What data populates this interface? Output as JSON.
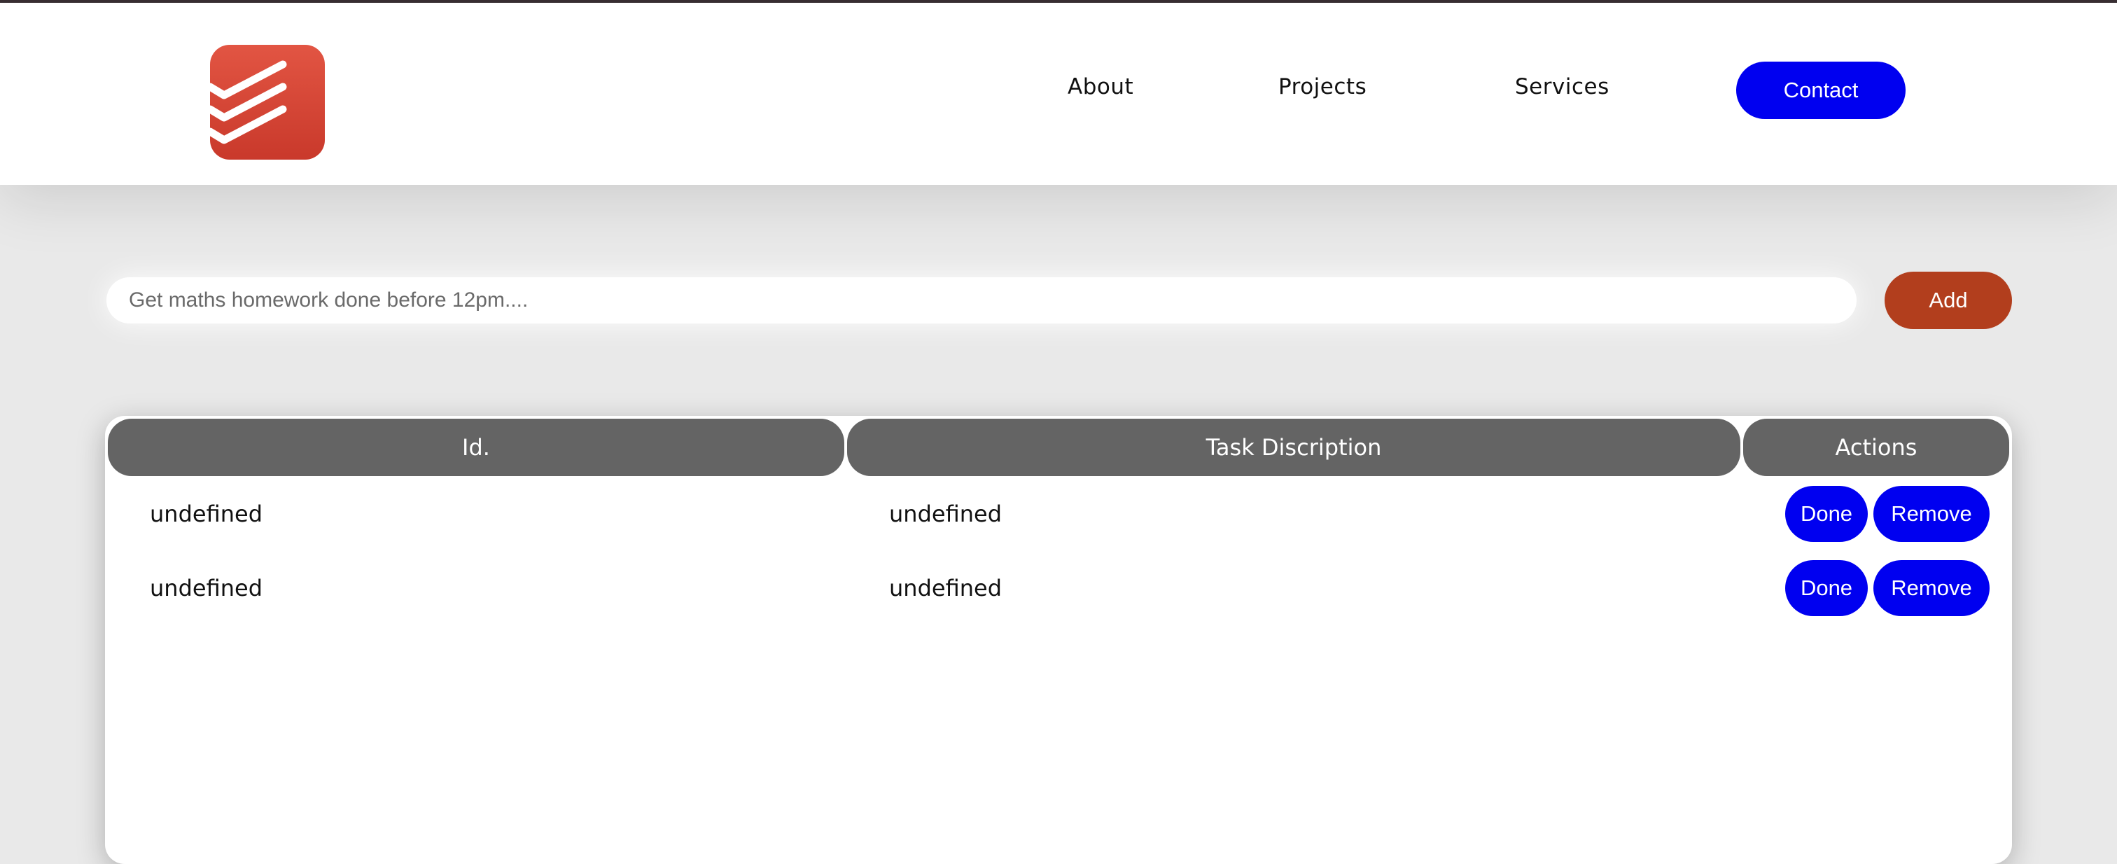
{
  "header": {
    "logo_icon": "todoist-logo-icon",
    "nav": [
      {
        "label": "About"
      },
      {
        "label": "Projects"
      },
      {
        "label": "Services"
      }
    ],
    "contact_label": "Contact"
  },
  "task_form": {
    "placeholder": "Get maths homework done before 12pm....",
    "add_label": "Add"
  },
  "table": {
    "columns": [
      "Id.",
      "Task Discription",
      "Actions"
    ],
    "rows": [
      {
        "id": "undefined",
        "description": "undefined",
        "done_label": "Done",
        "remove_label": "Remove"
      },
      {
        "id": "undefined",
        "description": "undefined",
        "done_label": "Done",
        "remove_label": "Remove"
      }
    ]
  },
  "colors": {
    "accent_blue": "#0000f0",
    "add_button": "#b23e1d",
    "header_cell": "#646464",
    "logo": "#db4c3f"
  }
}
